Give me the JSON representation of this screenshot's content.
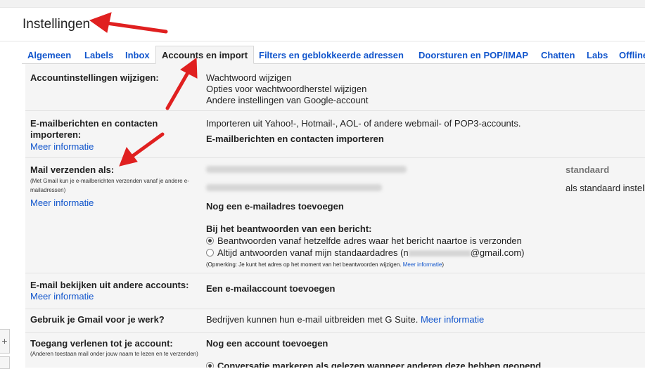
{
  "page": {
    "title": "Instellingen"
  },
  "tabs": [
    {
      "label": "Algemeen"
    },
    {
      "label": "Labels"
    },
    {
      "label": "Inbox"
    },
    {
      "label": "Accounts en import"
    },
    {
      "label": "Filters en geblokkeerde adressen"
    },
    {
      "label": "Doorsturen en POP/IMAP"
    },
    {
      "label": "Chatten"
    },
    {
      "label": "Labs"
    },
    {
      "label": "Offline"
    }
  ],
  "sections": {
    "account_settings": {
      "label": "Accountinstellingen wijzigen:",
      "links": [
        "Wachtwoord wijzigen",
        "Opties voor wachtwoordherstel wijzigen",
        "Andere instellingen van Google-account"
      ]
    },
    "import": {
      "label": "E-mailberichten en contacten importeren:",
      "more": "Meer informatie",
      "description": "Importeren uit Yahoo!-, Hotmail-, AOL- of andere webmail- of POP3-accounts.",
      "action": "E-mailberichten en contacten importeren"
    },
    "send_as": {
      "label": "Mail verzenden als:",
      "sublabel": "(Met Gmail kun je e-mailberichten verzenden vanaf je andere e-mailadressen)",
      "more": "Meer informatie",
      "default_label": "standaard",
      "make_default": "als standaard instellen",
      "add_address": "Nog een e-mailadres toevoegen",
      "reply_heading": "Bij het beantwoorden van een bericht:",
      "reply_option1": "Beantwoorden vanaf hetzelfde adres waar het bericht naartoe is verzonden",
      "reply_option2_prefix": "Altijd antwoorden vanaf mijn standaardadres (n",
      "reply_option2_suffix": "@gmail.com)",
      "note": "(Opmerking: Je kunt het adres op het moment van het beantwoorden wijzigen.",
      "note_more": "Meer informatie",
      "note_close": ")"
    },
    "check_mail": {
      "label": "E-mail bekijken uit andere accounts:",
      "more": "Meer informatie",
      "action": "Een e-mailaccount toevoegen"
    },
    "work": {
      "label": "Gebruik je Gmail voor je werk?",
      "description": "Bedrijven kunnen hun e-mail uitbreiden met G Suite.",
      "more": "Meer informatie"
    },
    "grant_access": {
      "label": "Toegang verlenen tot je account:",
      "sublabel": "(Anderen toestaan mail onder jouw naam te lezen en te verzenden)",
      "action": "Nog een account toevoegen",
      "option1": "Conversatie markeren als gelezen wanneer anderen deze hebben geopend"
    }
  },
  "colors": {
    "link": "#1155cc",
    "annotation_arrow": "#e02020",
    "panel_bg": "#f5f5f5"
  }
}
